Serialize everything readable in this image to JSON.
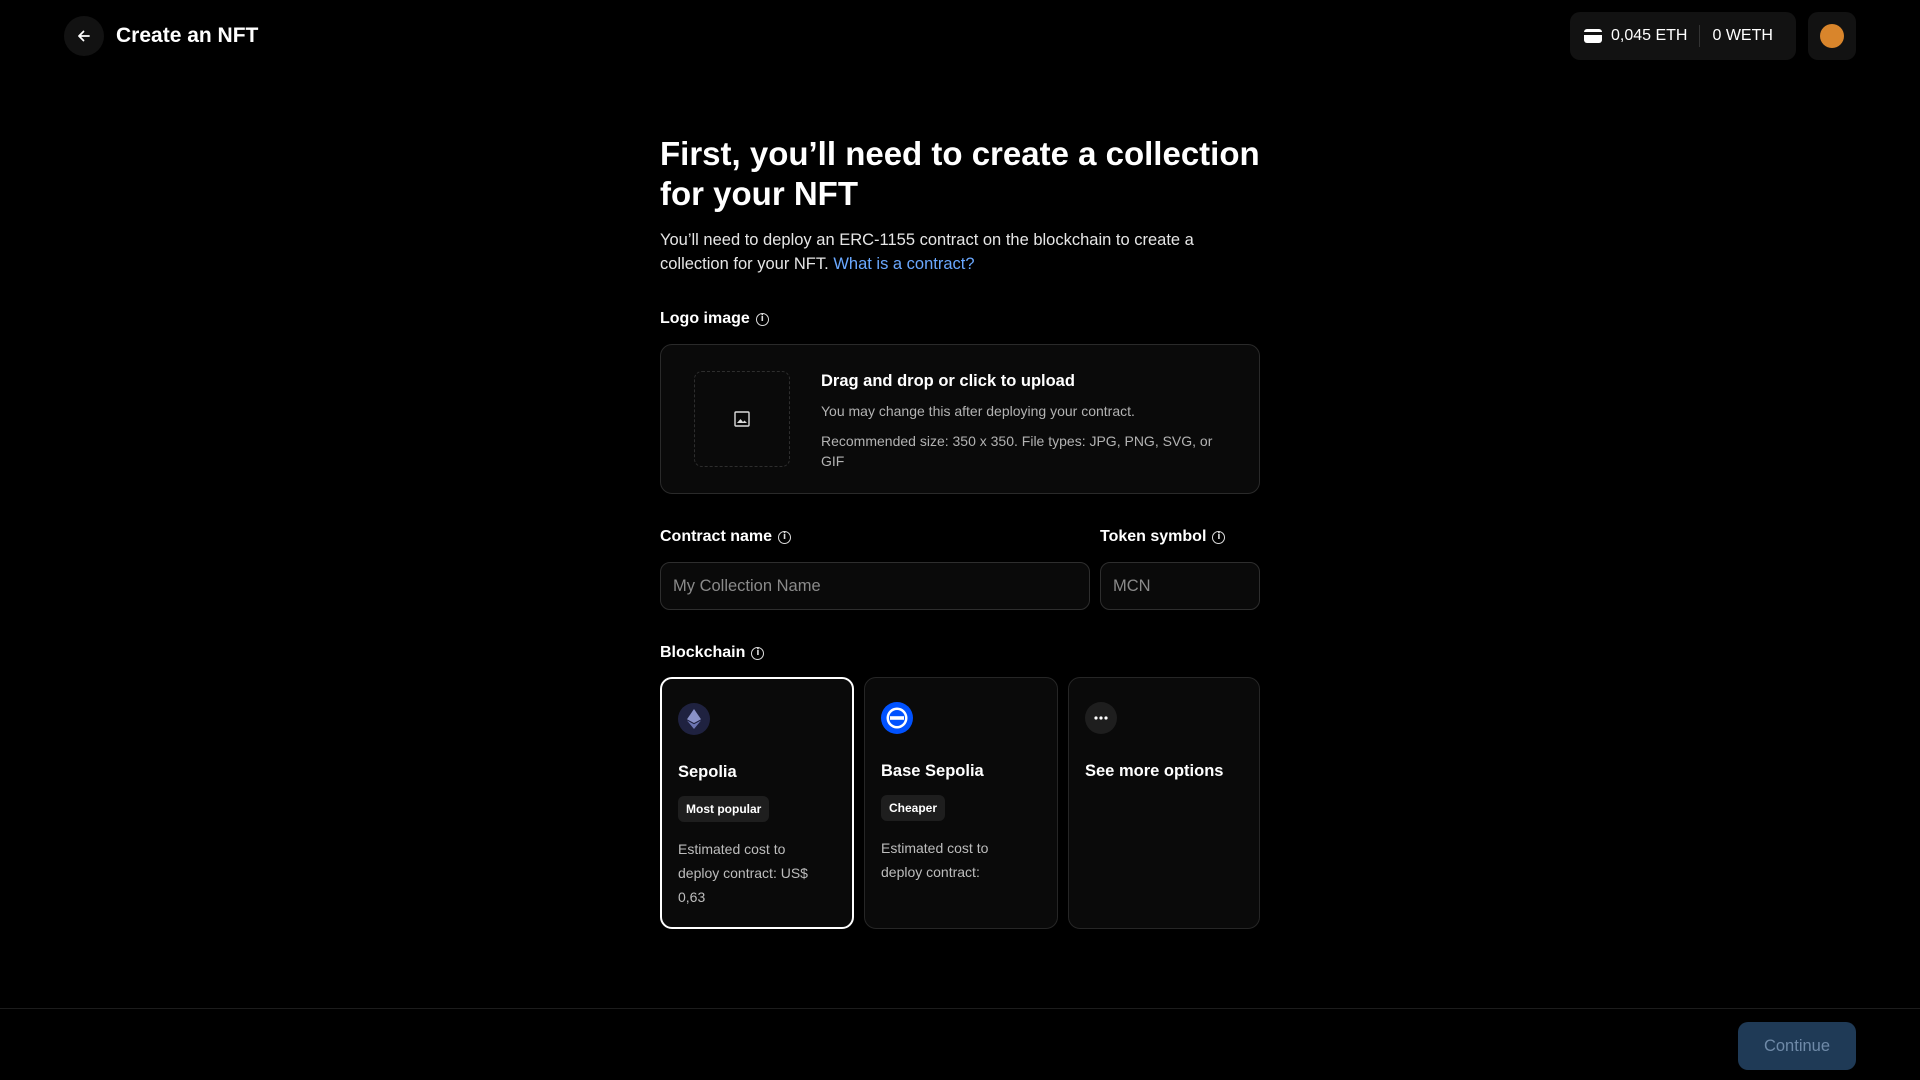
{
  "header": {
    "title": "Create an NFT",
    "wallet": {
      "eth_balance": "0,045 ETH",
      "weth_balance": "0 WETH"
    },
    "avatar_color": "#d9852b"
  },
  "main": {
    "headline": "First, you’ll need to create a collection for your NFT",
    "intro_text": "You’ll need to deploy an ERC-1155 contract on the blockchain to create a collection for your NFT.",
    "intro_link": "What is a contract?",
    "logo": {
      "label": "Logo image",
      "upload_title": "Drag and drop or click to upload",
      "upload_line1": "You may change this after deploying your contract.",
      "upload_line2": "Recommended size: 350 x 350. File types: JPG, PNG, SVG, or GIF"
    },
    "contract_name": {
      "label": "Contract name",
      "placeholder": "My Collection Name"
    },
    "token_symbol": {
      "label": "Token symbol",
      "placeholder": "MCN"
    },
    "blockchain": {
      "label": "Blockchain",
      "options": [
        {
          "name": "Sepolia",
          "badge": "Most popular",
          "cost": "Estimated cost to deploy contract: US$ 0,63",
          "icon": "ethereum-icon",
          "selected": true
        },
        {
          "name": "Base Sepolia",
          "badge": "Cheaper",
          "cost": "Estimated cost to deploy contract:",
          "icon": "base-icon",
          "selected": false
        },
        {
          "name": "See more options",
          "icon": "more-icon",
          "selected": false
        }
      ]
    }
  },
  "footer": {
    "continue_label": "Continue"
  }
}
